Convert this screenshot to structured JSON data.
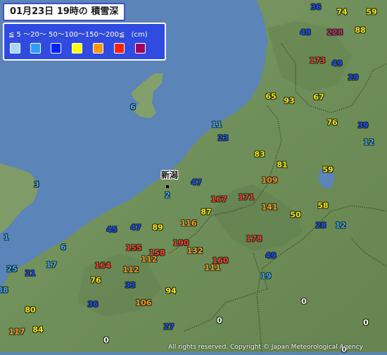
{
  "map": {
    "title": "01月23日 19時の 積雪深",
    "city_label": "新潟",
    "copyright": "All rights reserved. Copyright © Japan Meteorological Agency"
  },
  "legend": {
    "labels": "≦ 5 〜20〜 50〜100〜150〜200≦",
    "unit": "(cm)",
    "colors": [
      "#a8d8ff",
      "#2f9cff",
      "#0022ff",
      "#ffff00",
      "#ff9900",
      "#ff2200",
      "#a0005a"
    ]
  },
  "colors": {
    "sea": "#5b84b8",
    "land": "#6f8f5a"
  },
  "stations": [
    {
      "value": "36",
      "color": "#1a49ff"
    },
    {
      "value": "74",
      "color": "#ffe600"
    },
    {
      "value": "59",
      "color": "#ffe600"
    },
    {
      "value": "48",
      "color": "#1a49ff"
    },
    {
      "value": "228",
      "color": "#d62479"
    },
    {
      "value": "88",
      "color": "#ffe600"
    },
    {
      "value": "173",
      "color": "#ff3c28"
    },
    {
      "value": "49",
      "color": "#1a49ff"
    },
    {
      "value": "29",
      "color": "#1a49ff"
    },
    {
      "value": "6",
      "color": "#41a7ff"
    },
    {
      "value": "65",
      "color": "#ffe600"
    },
    {
      "value": "93",
      "color": "#ffe600"
    },
    {
      "value": "67",
      "color": "#ffe600"
    },
    {
      "value": "11",
      "color": "#41a7ff"
    },
    {
      "value": "23",
      "color": "#1a49ff"
    },
    {
      "value": "76",
      "color": "#ffe600"
    },
    {
      "value": "39",
      "color": "#1a49ff"
    },
    {
      "value": "12",
      "color": "#41a7ff"
    },
    {
      "value": "83",
      "color": "#ffe600"
    },
    {
      "value": "81",
      "color": "#ffe600"
    },
    {
      "value": "59",
      "color": "#ffe600"
    },
    {
      "value": "109",
      "color": "#ff9a1a"
    },
    {
      "value": "47",
      "color": "#1a49ff"
    },
    {
      "value": "167",
      "color": "#ff3c28"
    },
    {
      "value": "171",
      "color": "#ff3c28"
    },
    {
      "value": "141",
      "color": "#ff9a1a"
    },
    {
      "value": "58",
      "color": "#ffe600"
    },
    {
      "value": "3",
      "color": "#41a7ff"
    },
    {
      "value": "2",
      "color": "#41a7ff"
    },
    {
      "value": "87",
      "color": "#ffe600"
    },
    {
      "value": "50",
      "color": "#ffe600"
    },
    {
      "value": "116",
      "color": "#ff9a1a"
    },
    {
      "value": "28",
      "color": "#1a49ff"
    },
    {
      "value": "12",
      "color": "#41a7ff"
    },
    {
      "value": "45",
      "color": "#1a49ff"
    },
    {
      "value": "47",
      "color": "#1a49ff"
    },
    {
      "value": "89",
      "color": "#ffe600"
    },
    {
      "value": "178",
      "color": "#ff3c28"
    },
    {
      "value": "190",
      "color": "#ff3c28"
    },
    {
      "value": "1",
      "color": "#41a7ff"
    },
    {
      "value": "6",
      "color": "#41a7ff"
    },
    {
      "value": "155",
      "color": "#ff3c28"
    },
    {
      "value": "158",
      "color": "#ff3c28"
    },
    {
      "value": "132",
      "color": "#ff9a1a"
    },
    {
      "value": "112",
      "color": "#ff9a1a"
    },
    {
      "value": "160",
      "color": "#ff3c28"
    },
    {
      "value": "49",
      "color": "#1a49ff"
    },
    {
      "value": "25",
      "color": "#41a7ff"
    },
    {
      "value": "17",
      "color": "#41a7ff"
    },
    {
      "value": "164",
      "color": "#ff3c28"
    },
    {
      "value": "112",
      "color": "#ff9a1a"
    },
    {
      "value": "111",
      "color": "#ff9a1a"
    },
    {
      "value": "21",
      "color": "#1a49ff"
    },
    {
      "value": "19",
      "color": "#41a7ff"
    },
    {
      "value": "76",
      "color": "#ffe600"
    },
    {
      "value": "88",
      "color": "#41a7ff"
    },
    {
      "value": "33",
      "color": "#1a49ff"
    },
    {
      "value": "94",
      "color": "#ffe600"
    },
    {
      "value": "36",
      "color": "#1a49ff"
    },
    {
      "value": "80",
      "color": "#ffe600"
    },
    {
      "value": "106",
      "color": "#ff9a1a"
    },
    {
      "value": "0",
      "color": "#ffffff"
    },
    {
      "value": "0",
      "color": "#ffffff"
    },
    {
      "value": "27",
      "color": "#1a49ff"
    },
    {
      "value": "0",
      "color": "#ffffff"
    },
    {
      "value": "117",
      "color": "#ff9a1a"
    },
    {
      "value": "84",
      "color": "#ffe600"
    },
    {
      "value": "0",
      "color": "#ffffff"
    },
    {
      "value": "0",
      "color": "#ffffff"
    }
  ]
}
